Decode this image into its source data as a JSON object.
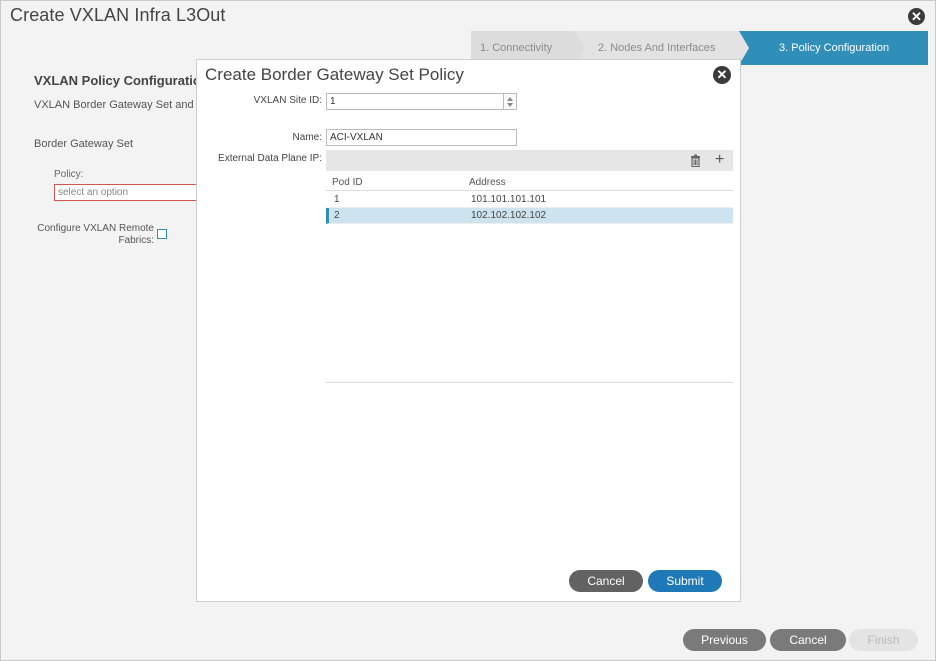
{
  "outer": {
    "title": "Create VXLAN Infra L3Out",
    "close_glyph": "✕"
  },
  "wizard": {
    "steps": [
      {
        "label": "1. Connectivity"
      },
      {
        "label": "2. Nodes And Interfaces"
      },
      {
        "label": "3. Policy Configuration"
      }
    ]
  },
  "background": {
    "section_title": "VXLAN Policy Configuratio",
    "section_desc": "VXLAN Border Gateway Set and",
    "border_gateway_set_label": "Border Gateway Set",
    "policy_label": "Policy:",
    "policy_placeholder": "select an option",
    "remote_fabrics_label": "Configure VXLAN Remote Fabrics:"
  },
  "footer": {
    "previous": "Previous",
    "cancel": "Cancel",
    "finish": "Finish"
  },
  "modal": {
    "title": "Create Border Gateway Set Policy",
    "close_glyph": "✕",
    "site_id_label": "VXLAN Site ID:",
    "site_id_value": "1",
    "name_label": "Name:",
    "name_value": "ACI-VXLAN",
    "ext_ip_label": "External Data Plane IP:",
    "plus_glyph": "+",
    "table": {
      "columns": [
        "Pod ID",
        "Address"
      ],
      "rows": [
        {
          "pod_id": "1",
          "address": "101.101.101.101"
        },
        {
          "pod_id": "2",
          "address": "102.102.102.102"
        }
      ]
    },
    "cancel": "Cancel",
    "submit": "Submit"
  },
  "colors": {
    "accent": "#2f8fb8",
    "submit": "#1f79b7",
    "selected_row": "#cde4f0",
    "error_border": "#d9534f"
  }
}
